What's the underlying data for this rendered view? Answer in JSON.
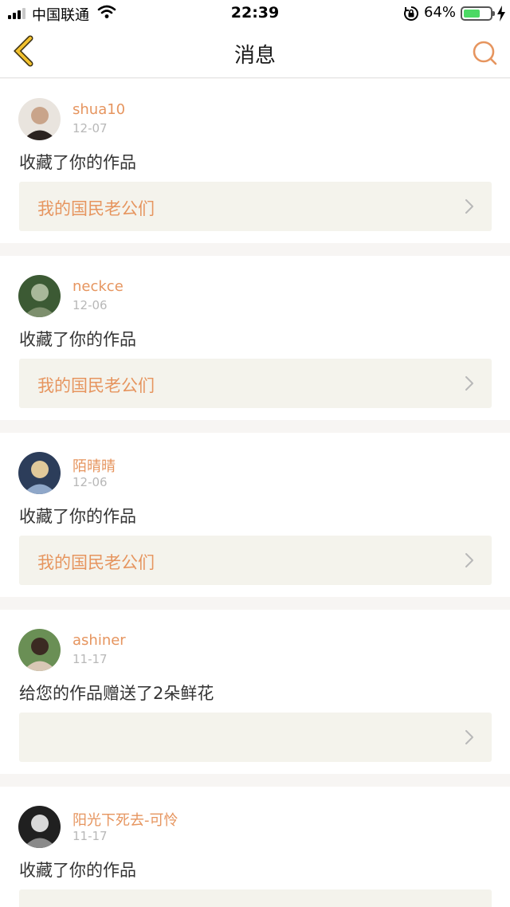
{
  "status_bar": {
    "carrier": "中国联通",
    "time": "22:39",
    "battery_percent": "64%",
    "battery_level": 0.64,
    "icons": [
      "signal-icon",
      "wifi-icon",
      "rotation-lock-icon",
      "battery-icon",
      "charging-bolt-icon"
    ]
  },
  "header": {
    "title": "消息",
    "back_icon": "chevron-left-icon",
    "search_icon": "search-icon"
  },
  "colors": {
    "accent": "#e6955f",
    "back_arrow": "#f2c12e",
    "card_box": "#f4f3ec",
    "page_bg": "#f7f5f3"
  },
  "messages": [
    {
      "username": "shua10",
      "date": "12-07",
      "action": "收藏了你的作品",
      "work_title": "我的国民老公们",
      "avatar": "avatar-photo"
    },
    {
      "username": "neckce",
      "date": "12-06",
      "action": "收藏了你的作品",
      "work_title": "我的国民老公们",
      "avatar": "avatar-photo"
    },
    {
      "username": "陌晴晴",
      "date": "12-06",
      "action": "收藏了你的作品",
      "work_title": "我的国民老公们",
      "avatar": "avatar-photo"
    },
    {
      "username": "ashiner",
      "date": "11-17",
      "action": "给您的作品赠送了2朵鲜花",
      "work_title": "",
      "avatar": "avatar-photo"
    },
    {
      "username": "阳光下死去-可怜",
      "date": "11-17",
      "action": "收藏了你的作品",
      "work_title": "",
      "avatar": "avatar-photo"
    }
  ]
}
